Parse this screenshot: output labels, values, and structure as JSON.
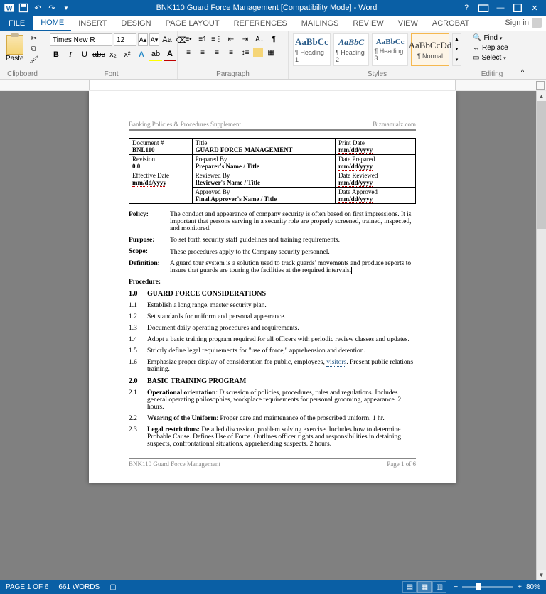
{
  "titlebar": {
    "title": "BNK110 Guard Force Management [Compatibility Mode] - Word"
  },
  "tabs": {
    "file": "FILE",
    "home": "HOME",
    "insert": "INSERT",
    "design": "DESIGN",
    "page_layout": "PAGE LAYOUT",
    "references": "REFERENCES",
    "mailings": "MAILINGS",
    "review": "REVIEW",
    "view": "VIEW",
    "acrobat": "ACROBAT",
    "signin": "Sign in"
  },
  "ribbon": {
    "clipboard": {
      "paste": "Paste",
      "label": "Clipboard"
    },
    "font": {
      "name": "Times New R",
      "size": "12",
      "bold": "B",
      "italic": "I",
      "underline": "U",
      "label": "Font"
    },
    "paragraph": {
      "label": "Paragraph"
    },
    "styles": {
      "s1": "AaBbCc",
      "s2": "AaBbC",
      "s3": "AaBbCc",
      "s4": "AaBbCcDd",
      "n1": "¶ Heading 1",
      "n2": "¶ Heading 2",
      "n3": "¶ Heading 3",
      "n4": "¶ Normal",
      "label": "Styles"
    },
    "editing": {
      "find": "Find",
      "replace": "Replace",
      "select": "Select",
      "label": "Editing"
    }
  },
  "doc": {
    "header_left": "Banking Policies & Procedures Supplement",
    "header_right": "Bizmanualz.com",
    "meta": {
      "docnum_h": "Document #",
      "docnum": "BNL110",
      "title_h": "Title",
      "title_v": "GUARD FORCE MANAGEMENT",
      "printdate_h": "Print Date",
      "printdate_v": "mm/dd/yyyy",
      "rev_h": "Revision",
      "rev_v": "0.0",
      "prep_h": "Prepared By",
      "prep_v": "Preparer's Name / Title",
      "dateprep_h": "Date Prepared",
      "dateprep_v": "mm/dd/yyyy",
      "eff_h": "Effective Date",
      "eff_v": "mm/dd/yyyy",
      "revw_h": "Reviewed By",
      "revw_v": "Reviewer's Name / Title",
      "daterev_h": "Date Reviewed",
      "daterev_v": "mm/dd/yyyy",
      "appr_h": "Approved By",
      "appr_v": "Final Approver's Name / Title",
      "dateapp_h": "Date Approved",
      "dateapp_v": "mm/dd/yyyy"
    },
    "policy_l": "Policy:",
    "policy_t": "The conduct and appearance of company security is often based on first impressions.  It is important that persons serving in a security role are properly screened, trained, inspected, and monitored.",
    "purpose_l": "Purpose:",
    "purpose_t": "To set forth security staff guidelines and training requirements.",
    "scope_l": "Scope:",
    "scope_t1": "These procedures apply to ",
    "scope_t2": "the Company",
    "scope_t3": " security personnel.",
    "def_l": "Definition:",
    "def_t1": "A ",
    "def_link": "guard tour system",
    "def_t2": " is a solution used to track guards' movements and produce reports to insure that guards are touring the facilities at the required intervals.",
    "proc_l": "Procedure:",
    "s1_0": "1.0",
    "s1_h": "GUARD FORCE CONSIDERATIONS",
    "s1_1n": "1.1",
    "s1_1": "Establish a long range, master security plan.",
    "s1_2n": "1.2",
    "s1_2": "Set standards for uniform and personal appearance.",
    "s1_3n": "1.3",
    "s1_3": "Document daily operating procedures and requirements.",
    "s1_4n": "1.4",
    "s1_4": "Adopt a basic training program required for all officers with periodic review classes and updates.",
    "s1_5n": "1.5",
    "s1_5": "Strictly define legal requirements for \"use of force,\" apprehension and detention.",
    "s1_6n": "1.6",
    "s1_6a": "Emphasize proper display of consideration for public, employees, ",
    "s1_6b": "visitors",
    "s1_6c": ".  Present public relations training.",
    "s2_0": "2.0",
    "s2_h": "BASIC TRAINING PROGRAM",
    "s2_1n": "2.1",
    "s2_1a": "Operational orientation",
    "s2_1b": ":  Discussion of policies, procedures, rules and regulations.  Includes general operating philosophies, workplace requirements for personal grooming, appearance. 2 hours.",
    "s2_2n": "2.2",
    "s2_2a": "Wearing of the Uniform",
    "s2_2b": ":  Proper care and maintenance of the proscribed uniform.  1 hr.",
    "s2_3n": "2.3",
    "s2_3a": "Legal restrictions:",
    "s2_3b": "  Detailed discussion, problem solving exercise.  Includes how to determine Probable Cause.  Defines Use of Force.  Outlines officer rights and responsibilities in detaining suspects, confrontational situations, apprehending suspects.  2 hours.",
    "footer_left": "BNK110 Guard Force Management",
    "footer_right": "Page 1 of 6"
  },
  "status": {
    "page": "PAGE 1 OF 6",
    "words": "661 WORDS",
    "zoom": "80%"
  }
}
